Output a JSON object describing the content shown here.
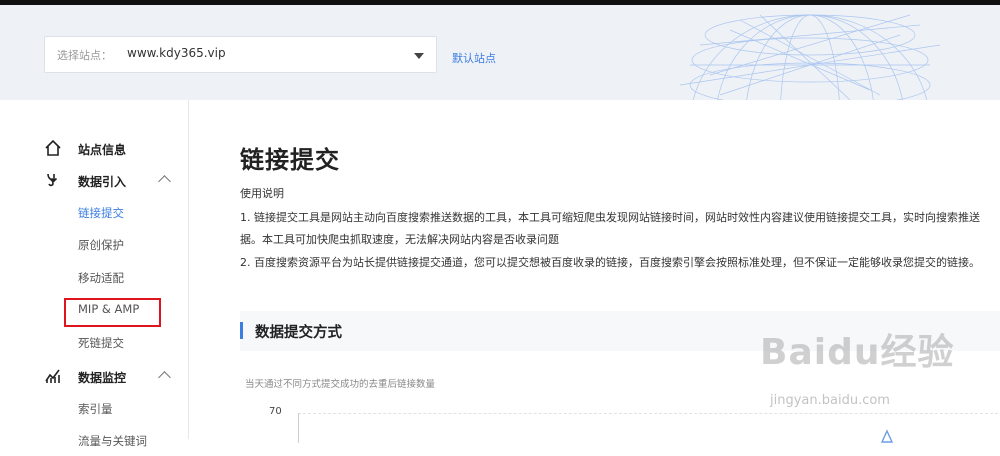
{
  "header": {
    "site_select_label": "选择站点：",
    "site_select_value": "www.kdy365.vip",
    "default_site_link": "默认站点"
  },
  "sidebar": {
    "items": [
      {
        "label": "站点信息",
        "type": "section",
        "icon": "home-icon"
      },
      {
        "label": "数据引入",
        "type": "section",
        "icon": "data-import-icon",
        "expanded": true
      },
      {
        "label": "链接提交",
        "type": "sub",
        "active": true
      },
      {
        "label": "原创保护",
        "type": "sub"
      },
      {
        "label": "移动适配",
        "type": "sub"
      },
      {
        "label": "MIP & AMP",
        "type": "sub"
      },
      {
        "label": "死链提交",
        "type": "sub"
      },
      {
        "label": "数据监控",
        "type": "section",
        "icon": "chart-monitor-icon",
        "expanded": true
      },
      {
        "label": "索引量",
        "type": "sub"
      },
      {
        "label": "流量与关键词",
        "type": "sub"
      }
    ]
  },
  "main": {
    "title": "链接提交",
    "usage_heading": "使用说明",
    "usage_lines": [
      "1. 链接提交工具是网站主动向百度搜索推送数据的工具，本工具可缩短爬虫发现网站链接时间，网站时效性内容建议使用链接提交工具，实时向搜索推送",
      "据。本工具可加快爬虫抓取速度，无法解决网站内容是否收录问题",
      "2. 百度搜索资源平台为站长提供链接提交通道，您可以提交想被百度收录的链接，百度搜索引擎会按照标准处理，但不保证一定能够收录您提交的链接。"
    ],
    "section_title": "数据提交方式",
    "chart_caption": "当天通过不同方式提交成功的去重后链接数量",
    "y_tick_top": "70"
  },
  "watermark": {
    "brand": "Baidu经验",
    "url": "jingyan.baidu.com"
  },
  "colors": {
    "accent": "#3b7de0",
    "highlight_box": "#e0141e",
    "header_bg": "#eef1f6"
  }
}
